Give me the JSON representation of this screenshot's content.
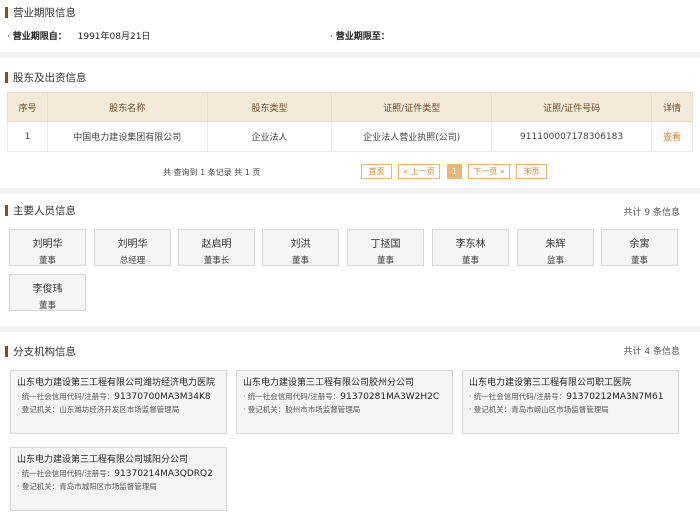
{
  "business_term": {
    "title": "营业期限信息",
    "from_label": "营业期限自：",
    "from_value": "1991年08月21日",
    "to_label": "营业期限至：",
    "to_value": ""
  },
  "shareholders": {
    "title": "股东及出资信息",
    "columns": [
      "序号",
      "股东名称",
      "股东类型",
      "证照/证件类型",
      "证照/证件号码",
      "详情"
    ],
    "rows": [
      [
        "1",
        "中国电力建设集团有限公司",
        "企业法人",
        "企业法人营业执照(公司)",
        "911100007178306183",
        "查看"
      ]
    ],
    "pager": {
      "summary": "共 查询到 1 条记录 共 1 页",
      "first": "首页",
      "prev": "« 上一页",
      "current": "1",
      "next": "下一页 »",
      "last": "末页"
    }
  },
  "personnel": {
    "title": "主要人员信息",
    "count": "共计 9 条信息",
    "people": [
      {
        "name": "刘明华",
        "role": "董事"
      },
      {
        "name": "刘明华",
        "role": "总经理"
      },
      {
        "name": "赵启明",
        "role": "董事长"
      },
      {
        "name": "刘洪",
        "role": "董事"
      },
      {
        "name": "丁拯国",
        "role": "董事"
      },
      {
        "name": "李东林",
        "role": "董事"
      },
      {
        "name": "朱辉",
        "role": "监事"
      },
      {
        "name": "余寓",
        "role": "董事"
      },
      {
        "name": "李俊玮",
        "role": "董事"
      }
    ]
  },
  "branches": {
    "title": "分支机构信息",
    "count": "共计 4 条信息",
    "code_label": "· 统一社会信用代码/注册号：",
    "authority_label": "· 登记机关：",
    "items": [
      {
        "name": "山东电力建设第三工程有限公司潍坊经济电力医院",
        "code": "91370700MA3M34K8",
        "authority": "山东潍坊经济开发区市场监督管理局"
      },
      {
        "name": "山东电力建设第三工程有限公司胶州分公司",
        "code": "91370281MA3W2H2C",
        "authority": "胶州市市场监督管理局"
      },
      {
        "name": "山东电力建设第三工程有限公司职工医院",
        "code": "91370212MA3N7M61",
        "authority": "青岛市崂山区市场监督管理局"
      },
      {
        "name": "山东电力建设第三工程有限公司城阳分公司",
        "code": "91370214MA3QDRQ2",
        "authority": "青岛市城阳区市场监督管理局"
      }
    ]
  }
}
